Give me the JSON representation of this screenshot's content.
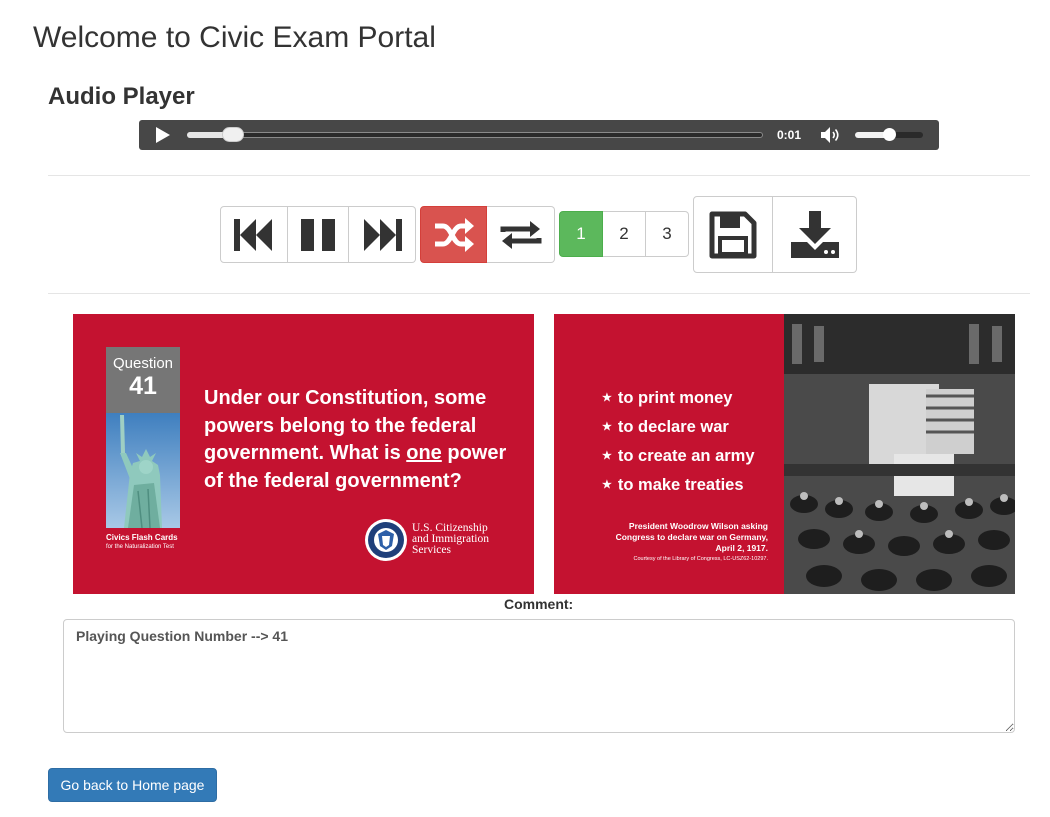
{
  "page": {
    "title": "Welcome to Civic Exam Portal"
  },
  "audio_section": {
    "heading": "Audio Player"
  },
  "audio_player": {
    "current_time": "0:01",
    "progress_fraction": 0.08,
    "volume_fraction": 0.5,
    "icons": {
      "play": "play-icon",
      "volume": "volume-icon"
    }
  },
  "controls": {
    "transport": [
      {
        "name": "previous-button",
        "icon": "fast-backward-icon"
      },
      {
        "name": "pause-button",
        "icon": "pause-icon"
      },
      {
        "name": "next-button",
        "icon": "fast-forward-icon"
      }
    ],
    "mode": [
      {
        "name": "shuffle-button",
        "icon": "shuffle-icon",
        "active": true,
        "color": "#d9534f"
      },
      {
        "name": "repeat-button",
        "icon": "repeat-icon",
        "active": false
      }
    ],
    "pagination": {
      "pages": [
        "1",
        "2",
        "3"
      ],
      "active": "1",
      "active_color": "#5cb85c"
    },
    "file": [
      {
        "name": "save-button",
        "icon": "floppy-disk-icon"
      },
      {
        "name": "download-button",
        "icon": "download-icon"
      }
    ]
  },
  "flash_card_front": {
    "question_label": "Question",
    "question_number": "41",
    "question_text_before": "Under our Constitution, some powers belong to the federal government. What is ",
    "question_text_emphasis": "one",
    "question_text_after": " power of the federal government?",
    "series_title": "Civics Flash Cards",
    "series_subtitle": "for the Naturalization Test",
    "agency_line1": "U.S. Citizenship",
    "agency_line2": "and Immigration",
    "agency_line3": "Services",
    "background_color": "#c41230"
  },
  "flash_card_back": {
    "answers": [
      "to print money",
      "to declare war",
      "to create an army",
      "to make treaties"
    ],
    "caption_line1": "President Woodrow Wilson asking",
    "caption_line2": "Congress to declare war on Germany,",
    "caption_line3": "April 2, 1917.",
    "credit": "Courtesy of the Library of Congress, LC-USZ62-10297."
  },
  "comment": {
    "label": "Comment:",
    "value": "Playing Question Number --> 41"
  },
  "navigation": {
    "home_button_label": "Go back to Home page",
    "home_button_color": "#337ab7"
  }
}
